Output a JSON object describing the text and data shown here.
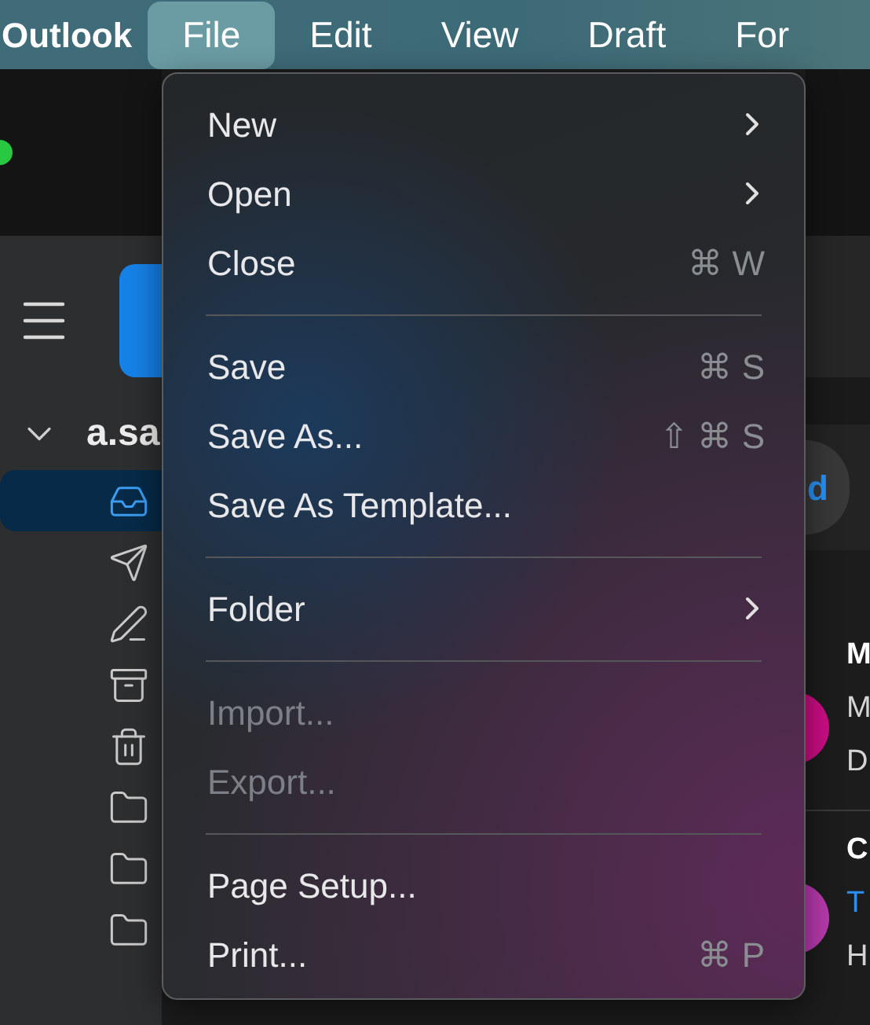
{
  "menu_bar": {
    "app_name": "Outlook",
    "items": [
      {
        "label": "File",
        "selected": true
      },
      {
        "label": "Edit",
        "selected": false
      },
      {
        "label": "View",
        "selected": false
      },
      {
        "label": "Draft",
        "selected": false
      },
      {
        "label": "For",
        "selected": false
      }
    ]
  },
  "sidebar": {
    "account": "a.sa",
    "folders": [
      {
        "kind": "inbox",
        "selected": true
      },
      {
        "kind": "sent",
        "selected": false
      },
      {
        "kind": "drafts",
        "selected": false
      },
      {
        "kind": "archive",
        "selected": false
      },
      {
        "kind": "trash",
        "selected": false
      },
      {
        "kind": "folder",
        "selected": false
      },
      {
        "kind": "folder",
        "selected": false
      },
      {
        "kind": "folder",
        "selected": false
      }
    ]
  },
  "message_list": {
    "filter_label": "d",
    "messages": [
      {
        "lines": [
          "M",
          "M",
          "D"
        ]
      },
      {
        "lines": [
          "C",
          "T",
          "H"
        ]
      }
    ]
  },
  "file_menu": {
    "groups": [
      [
        {
          "label": "New",
          "submenu": true,
          "disabled": false
        },
        {
          "label": "Open",
          "submenu": true,
          "disabled": false
        },
        {
          "label": "Close",
          "shortcut": "⌘ W",
          "submenu": false,
          "disabled": false
        }
      ],
      [
        {
          "label": "Save",
          "shortcut": "⌘ S",
          "submenu": false,
          "disabled": false
        },
        {
          "label": "Save As...",
          "shortcut": "⇧ ⌘ S",
          "submenu": false,
          "disabled": false
        },
        {
          "label": "Save As Template...",
          "submenu": false,
          "disabled": false
        }
      ],
      [
        {
          "label": "Folder",
          "submenu": true,
          "disabled": false
        }
      ],
      [
        {
          "label": "Import...",
          "submenu": false,
          "disabled": true
        },
        {
          "label": "Export...",
          "submenu": false,
          "disabled": true
        }
      ],
      [
        {
          "label": "Page Setup...",
          "submenu": false,
          "disabled": false
        },
        {
          "label": "Print...",
          "shortcut": "⌘ P",
          "submenu": false,
          "disabled": false
        }
      ]
    ]
  }
}
